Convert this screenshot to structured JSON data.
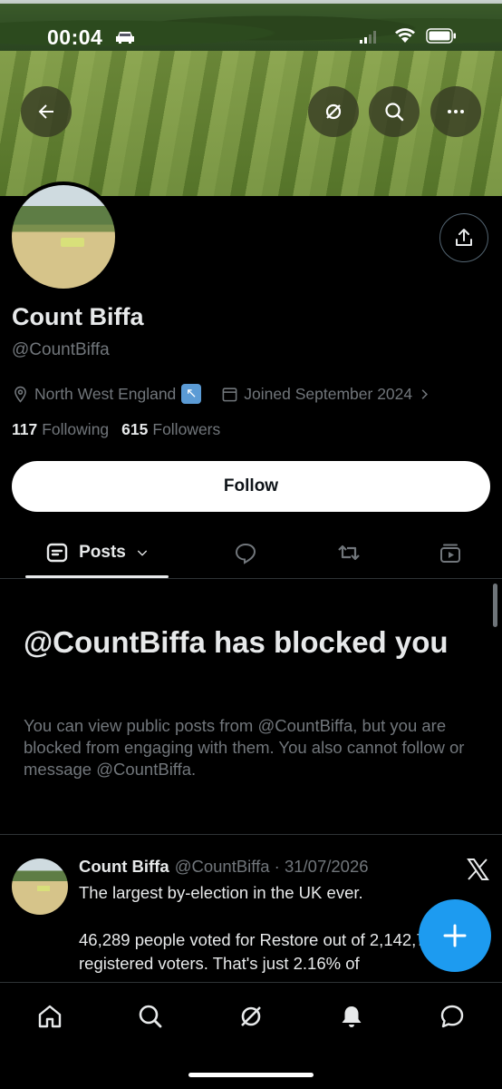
{
  "status_bar": {
    "time": "00:04"
  },
  "profile": {
    "name": "Count Biffa",
    "handle": "@CountBiffa",
    "location": "North West England",
    "location_emoji": "↖",
    "joined": "Joined September 2024",
    "following_count": "117",
    "following_label": "Following",
    "followers_count": "615",
    "followers_label": "Followers",
    "follow_button": "Follow"
  },
  "tabs": {
    "posts_label": "Posts"
  },
  "blocked": {
    "title": "@CountBiffa has blocked you",
    "description": "You can view public posts from @CountBiffa, but you are blocked from engaging with them. You also cannot follow or message @CountBiffa."
  },
  "post": {
    "author": "Count Biffa",
    "handle_date": "@CountBiffa · 31/07/2026",
    "line1": "The largest by-election in the UK ever.",
    "line2": "46,289 people voted for Restore out of 2,142,779 registered voters. That's just 2.16% of"
  },
  "icons": {
    "back": "arrow-left-icon",
    "grok": "grok-icon",
    "search": "search-icon",
    "more": "more-icon",
    "share": "share-icon",
    "location": "location-pin-icon",
    "calendar": "calendar-icon",
    "compose": "plus-icon"
  },
  "colors": {
    "accent": "#1d9bf0",
    "muted": "#71767b",
    "text": "#e7e9ea"
  }
}
